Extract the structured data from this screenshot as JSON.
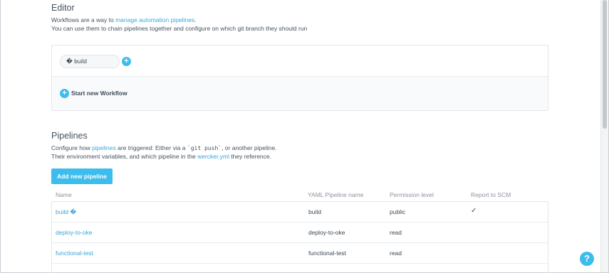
{
  "editor": {
    "title": "Editor",
    "desc_line1_prefix": "Workflows are a way to ",
    "desc_line1_link": "manage automation pipelines",
    "desc_line1_suffix": ".",
    "desc_line2": "You can use them to chain pipelines together and configure on which git branch they should run",
    "workflow_label": "� build",
    "add_glyph": "+",
    "start_new_workflow": "Start new Workflow"
  },
  "pipelines": {
    "title": "Pipelines",
    "desc_line1_prefix": "Configure how ",
    "desc_line1_link": "pipelines",
    "desc_line1_middle": " are triggered: Either via a ",
    "desc_line1_code": "`git push`",
    "desc_line1_suffix": ", or another pipeline.",
    "desc_line2_prefix": "Their environment variables, and which pipeline in the ",
    "desc_line2_link": "wercker.yml",
    "desc_line2_suffix": " they reference.",
    "add_button": "Add new pipeline",
    "columns": [
      "Name",
      "YAML Pipeline name",
      "Permission level",
      "Report to SCM"
    ],
    "rows": [
      {
        "name": "build �",
        "yaml": "build",
        "permission": "public",
        "scm": "✓"
      },
      {
        "name": "deploy-to-oke",
        "yaml": "deploy-to-oke",
        "permission": "read",
        "scm": ""
      },
      {
        "name": "functional-test",
        "yaml": "functional-test",
        "permission": "read",
        "scm": ""
      }
    ]
  },
  "help": {
    "glyph": "?"
  },
  "colors": {
    "accent": "#3dbdee",
    "link": "#3aa6d9",
    "text": "#3d4a57",
    "muted": "#8a949e"
  }
}
